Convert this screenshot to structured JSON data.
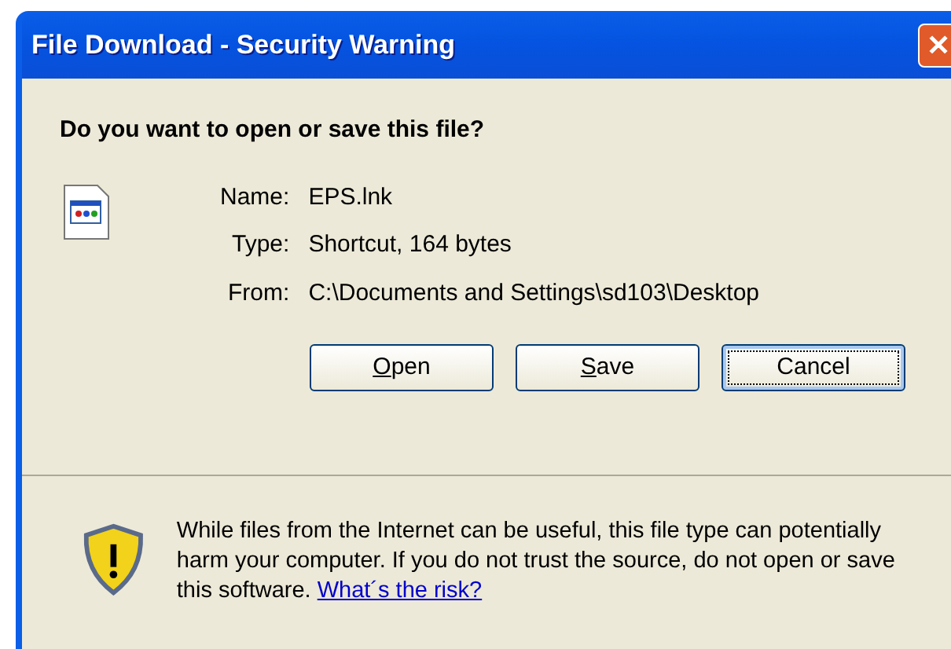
{
  "window": {
    "title": "File Download - Security Warning",
    "close_glyph": "✕"
  },
  "question": "Do you want to open or save this file?",
  "details": [
    {
      "label": "Name:",
      "value": "EPS.lnk"
    },
    {
      "label": "Type:",
      "value": "Shortcut, 164 bytes"
    },
    {
      "label": "From:",
      "value": "C:\\Documents and Settings\\sd103\\Desktop"
    }
  ],
  "buttons": [
    {
      "label": "Open",
      "first_letter_underlined": true,
      "focused": false
    },
    {
      "label": "Save",
      "first_letter_underlined": true,
      "focused": false
    },
    {
      "label": "Cancel",
      "first_letter_underlined": false,
      "focused": true
    }
  ],
  "warning": {
    "text": "While files from the Internet can be useful, this file type can potentially harm your computer. If you do not trust the source, do not open or save this software.",
    "link": "What´s the risk?"
  }
}
